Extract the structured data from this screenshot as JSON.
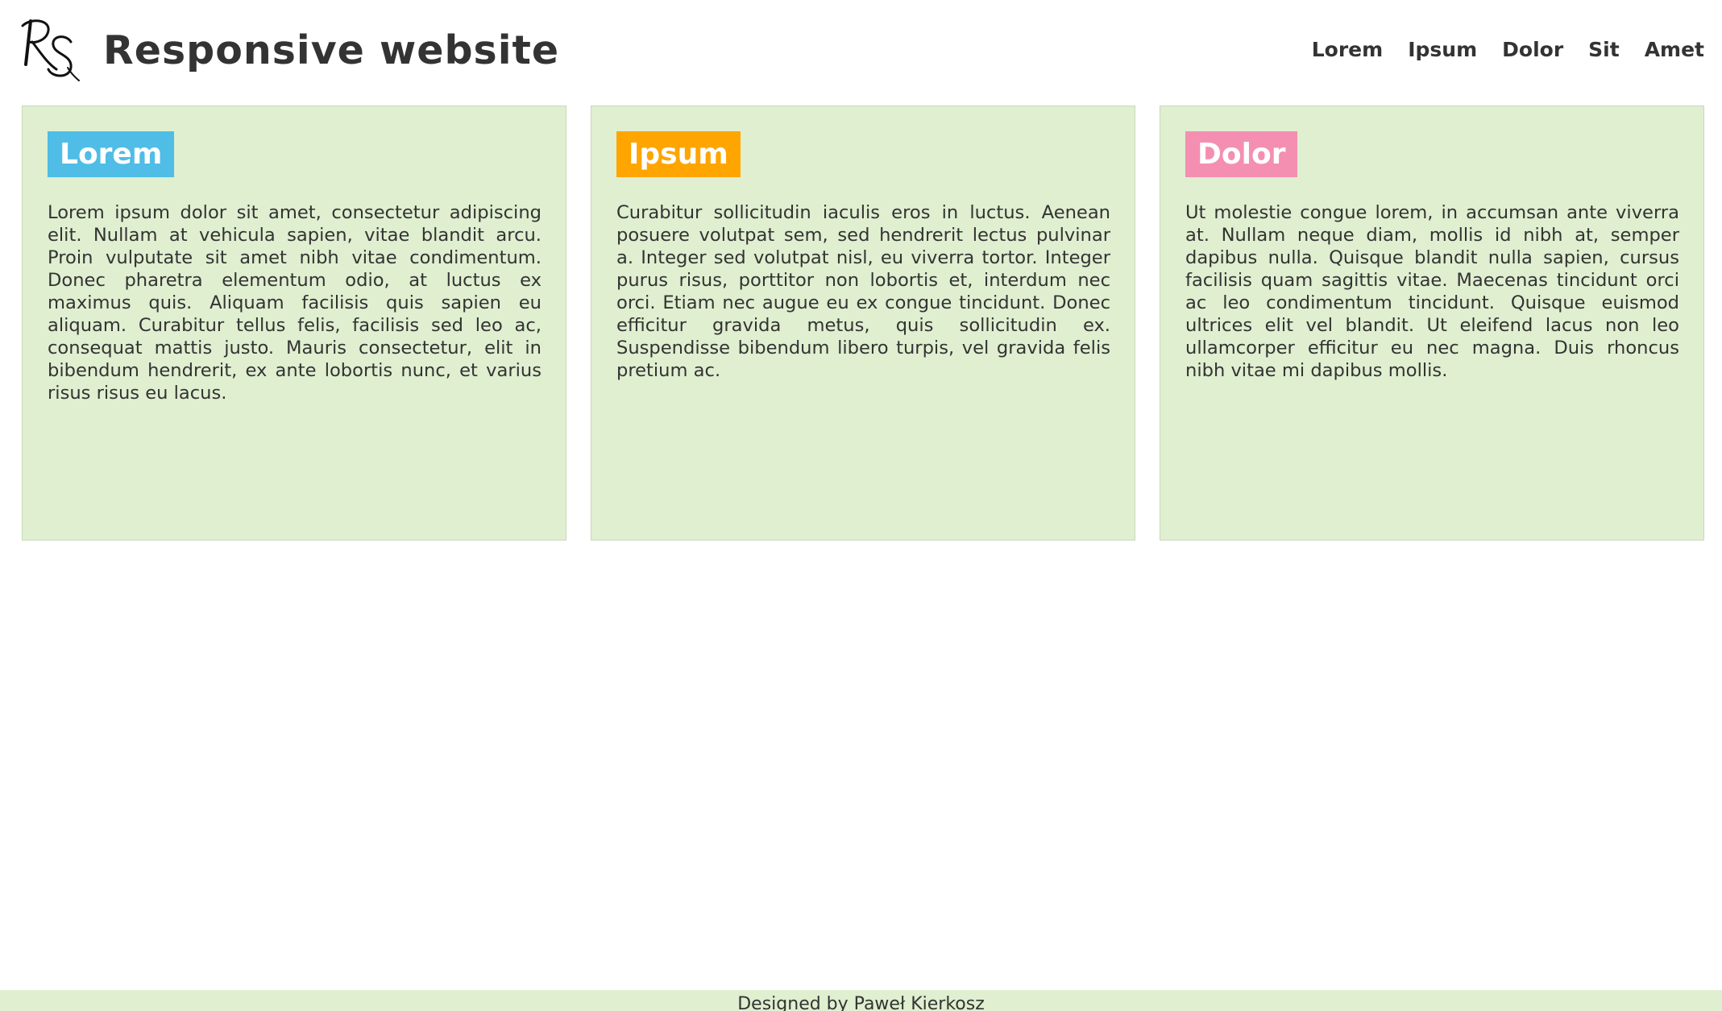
{
  "header": {
    "logo_icon": "rs-monogram-logo",
    "title": "Responsive website"
  },
  "nav": {
    "items": [
      {
        "label": "Lorem"
      },
      {
        "label": "Ipsum"
      },
      {
        "label": "Dolor"
      },
      {
        "label": "Sit"
      },
      {
        "label": "Amet"
      }
    ]
  },
  "cards": [
    {
      "title": "Lorem",
      "color": "#4fbde6",
      "text": "Lorem ipsum dolor sit amet, consectetur adipiscing elit. Nullam at vehicula sapien, vitae blandit arcu. Proin vulputate sit amet nibh vitae condimentum. Donec pharetra elementum odio, at luctus ex maximus quis. Aliquam facilisis quis sapien eu aliquam. Curabitur tellus felis, facilisis sed leo ac, consequat mattis justo. Mauris consectetur, elit in bibendum hendrerit, ex ante lobortis nunc, et varius risus risus eu lacus."
    },
    {
      "title": "Ipsum",
      "color": "#ffa500",
      "text": "Curabitur sollicitudin iaculis eros in luctus. Aenean posuere volutpat sem, sed hendrerit lectus pulvinar a. Integer sed volutpat nisl, eu viverra tortor. Integer purus risus, porttitor non lobortis et, interdum nec orci. Etiam nec augue eu ex congue tincidunt. Donec efficitur gravida metus, quis sollicitudin ex. Suspendisse bibendum libero turpis, vel gravida felis pretium ac."
    },
    {
      "title": "Dolor",
      "color": "#f48fb1",
      "text": "Ut molestie congue lorem, in accumsan ante viverra at. Nullam neque diam, mollis id nibh at, semper dapibus nulla. Quisque blandit nulla sapien, cursus facilisis quam sagittis vitae. Maecenas tincidunt orci ac leo condimentum tincidunt. Quisque euismod ultrices elit vel blandit. Ut eleifend lacus non leo ullamcorper efficitur eu nec magna. Duis rhoncus nibh vitae mi dapibus mollis."
    }
  ],
  "footer": {
    "text": "Designed by Paweł Kierkosz"
  }
}
